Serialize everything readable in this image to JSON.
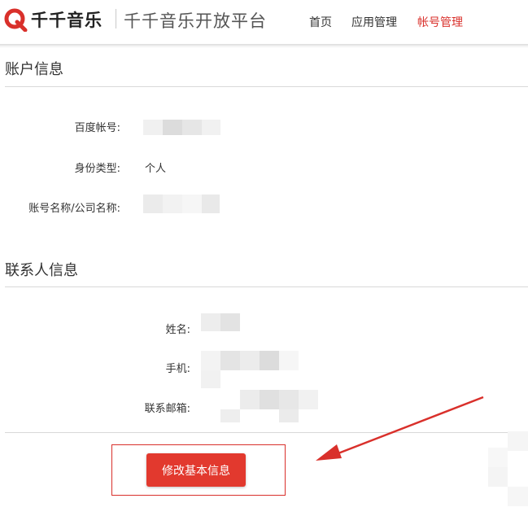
{
  "brand": {
    "logo_text": "千千音乐",
    "platform_title": "千千音乐开放平台"
  },
  "nav": {
    "home": "首页",
    "app_manage": "应用管理",
    "account_manage": "帐号管理"
  },
  "colors": {
    "accent": "#d9302b",
    "button": "#e2392e"
  },
  "account_info": {
    "title": "账户信息",
    "baidu_account_label": "百度帐号:",
    "identity_type_label": "身份类型:",
    "identity_type_value": "个人",
    "account_name_label": "账号名称/公司名称:"
  },
  "contact_info": {
    "title": "联系人信息",
    "name_label": "姓名:",
    "phone_label": "手机:",
    "email_label": "联系邮箱:"
  },
  "actions": {
    "edit_basic_info": "修改基本信息"
  },
  "icons": {
    "logo": "qianqian-logo-icon",
    "arrow": "annotation-arrow-icon"
  }
}
